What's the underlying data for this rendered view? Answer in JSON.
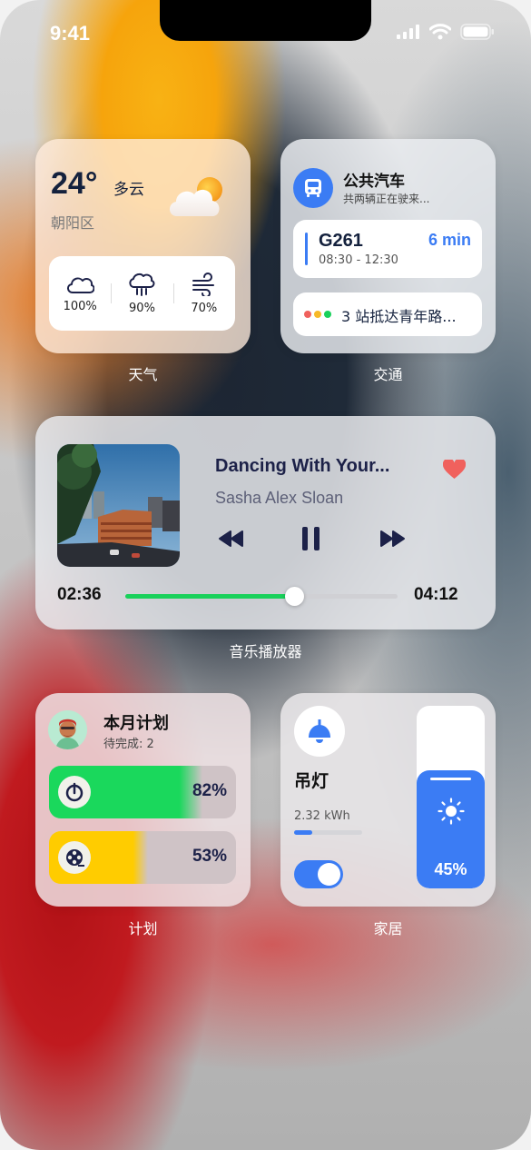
{
  "status_bar": {
    "time": "9:41"
  },
  "weather": {
    "temp": "24°",
    "condition": "多云",
    "district": "朝阳区",
    "stats": [
      {
        "icon": "cloud-icon",
        "value": "100%"
      },
      {
        "icon": "rain-icon",
        "value": "90%"
      },
      {
        "icon": "wind-icon",
        "value": "70%"
      }
    ],
    "label": "天气"
  },
  "traffic": {
    "title": "公共汽车",
    "subtitle": "共两辆正在驶来...",
    "route": {
      "number": "G261",
      "hours": "08:30 - 12:30",
      "eta": "6 min"
    },
    "stop_info": "3 站抵达青年路...",
    "label": "交通"
  },
  "music": {
    "song": "Dancing With Your...",
    "artist": "Sasha Alex Sloan",
    "current_time": "02:36",
    "total_time": "04:12",
    "progress": 0.62,
    "liked": true,
    "label": "音乐播放器"
  },
  "plan": {
    "title": "本月计划",
    "subtitle": "待完成: 2",
    "items": [
      {
        "icon": "timer-icon",
        "percent": 82,
        "percent_text": "82%",
        "color": "#1ad85c"
      },
      {
        "icon": "film-reel-icon",
        "percent": 53,
        "percent_text": "53%",
        "color": "#ffcc00"
      }
    ],
    "label": "计划"
  },
  "home": {
    "device": "吊灯",
    "energy": "2.32 kWh",
    "energy_level": 0.27,
    "power_on": true,
    "brightness": 45,
    "brightness_text": "45%",
    "label": "家居"
  },
  "colors": {
    "accent_blue": "#3b7cf4",
    "green": "#19d15b",
    "yellow": "#ffcc00",
    "heart": "#f0615d"
  }
}
